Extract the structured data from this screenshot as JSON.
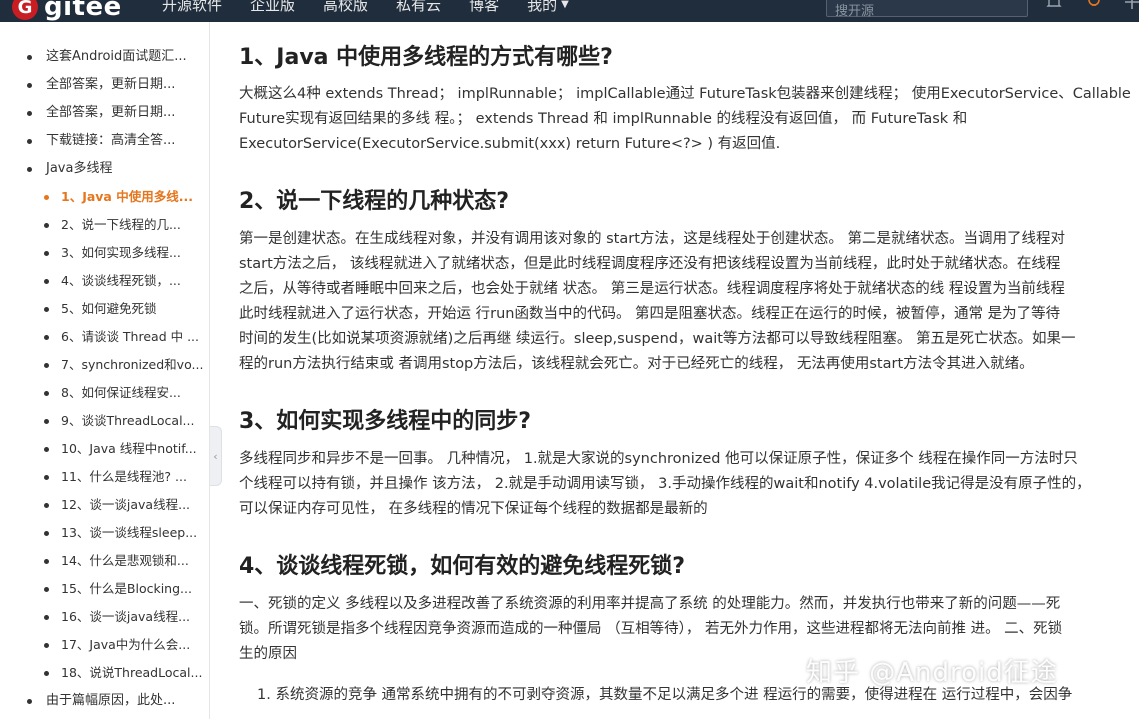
{
  "header": {
    "logo_mark": "G",
    "logo_text": "gitee",
    "nav": [
      "开源软件",
      "企业版",
      "高校版",
      "私有云",
      "博客",
      "我的"
    ],
    "search_placeholder": "搜开源"
  },
  "sidebar": {
    "items": [
      {
        "label": "这套Android面试题汇...",
        "level": 1,
        "active": false
      },
      {
        "label": "全部答案，更新日期...",
        "level": 1,
        "active": false
      },
      {
        "label": "全部答案，更新日期...",
        "level": 1,
        "active": false
      },
      {
        "label": "下载链接：高清全答...",
        "level": 1,
        "active": false
      },
      {
        "label": "Java多线程",
        "level": 1,
        "active": false
      },
      {
        "label": "1、Java 中使用多线...",
        "level": 2,
        "active": true
      },
      {
        "label": "2、说一下线程的几...",
        "level": 2,
        "active": false
      },
      {
        "label": "3、如何实现多线程...",
        "level": 2,
        "active": false
      },
      {
        "label": "4、谈谈线程死锁，...",
        "level": 2,
        "active": false
      },
      {
        "label": "5、如何避免死锁",
        "level": 2,
        "active": false
      },
      {
        "label": "6、请谈谈 Thread 中 ...",
        "level": 2,
        "active": false
      },
      {
        "label": "7、synchronized和vo...",
        "level": 2,
        "active": false
      },
      {
        "label": "8、如何保证线程安...",
        "level": 2,
        "active": false
      },
      {
        "label": "9、谈谈ThreadLocal...",
        "level": 2,
        "active": false
      },
      {
        "label": "10、Java 线程中notif...",
        "level": 2,
        "active": false
      },
      {
        "label": "11、什么是线程池? ...",
        "level": 2,
        "active": false
      },
      {
        "label": "12、谈一谈java线程...",
        "level": 2,
        "active": false
      },
      {
        "label": "13、谈一谈线程sleep...",
        "level": 2,
        "active": false
      },
      {
        "label": "14、什么是悲观锁和...",
        "level": 2,
        "active": false
      },
      {
        "label": "15、什么是Blocking...",
        "level": 2,
        "active": false
      },
      {
        "label": "16、谈一谈java线程...",
        "level": 2,
        "active": false
      },
      {
        "label": "17、Java中为什么会...",
        "level": 2,
        "active": false
      },
      {
        "label": "18、说说ThreadLocal...",
        "level": 2,
        "active": false
      },
      {
        "label": "由于篇幅原因，此处...",
        "level": 1,
        "active": false
      }
    ]
  },
  "article": {
    "sections": [
      {
        "title": "1、Java 中使用多线程的方式有哪些?",
        "lines": [
          "大概这么4种 extends Thread； implRunnable； implCallable通过 FutureTask包装器来创建线程； 使用ExecutorService、Callable",
          "Future实现有返回结果的多线 程。； extends Thread 和 implRunnable 的线程没有返回值， 而 FutureTask 和",
          "ExecutorService(ExecutorService.submit(xxx) return Future<?> ) 有返回值."
        ]
      },
      {
        "title": "2、说一下线程的几种状态?",
        "lines": [
          "第一是创建状态。在生成线程对象，并没有调用该对象的 start方法，这是线程处于创建状态。 第二是就绪状态。当调用了线程对",
          "start方法之后， 该线程就进入了就绪状态，但是此时线程调度程序还没有把该线程设置为当前线程，此时处于就绪状态。在线程",
          "之后，从等待或者睡眠中回来之后，也会处于就绪 状态。 第三是运行状态。线程调度程序将处于就绪状态的线 程设置为当前线程",
          "此时线程就进入了运行状态，开始运 行run函数当中的代码。 第四是阻塞状态。线程正在运行的时候，被暂停，通常 是为了等待",
          "时间的发生(比如说某项资源就绪)之后再继 续运行。sleep,suspend，wait等方法都可以导致线程阻塞。 第五是死亡状态。如果一",
          "程的run方法执行结束或 者调用stop方法后，该线程就会死亡。对于已经死亡的线程， 无法再使用start方法令其进入就绪。"
        ]
      },
      {
        "title": "3、如何实现多线程中的同步?",
        "lines": [
          "多线程同步和异步不是一回事。 几种情况， 1.就是大家说的synchronized 他可以保证原子性，保证多个 线程在操作同一方法时只",
          "个线程可以持有锁，并且操作 该方法， 2.就是手动调用读写锁， 3.手动操作线程的wait和notify 4.volatile我记得是没有原子性的，",
          "可以保证内存可见性， 在多线程的情况下保证每个线程的数据都是最新的"
        ]
      },
      {
        "title": "4、谈谈线程死锁，如何有效的避免线程死锁?",
        "lines": [
          "一、死锁的定义 多线程以及多进程改善了系统资源的利用率并提高了系统 的处理能力。然而，并发执行也带来了新的问题——死",
          "锁。所谓死锁是指多个线程因竞争资源而造成的一种僵局 （互相等待）， 若无外力作用，这些进程都将无法向前推 进。 二、死锁",
          "生的原因"
        ]
      }
    ],
    "list_item": "1. 系统资源的竞争 通常系统中拥有的不可剥夺资源，其数量不足以满足多个进 程运行的需要，使得进程在 运行过程中，会因争"
  },
  "watermark": "知乎 @Android征途"
}
